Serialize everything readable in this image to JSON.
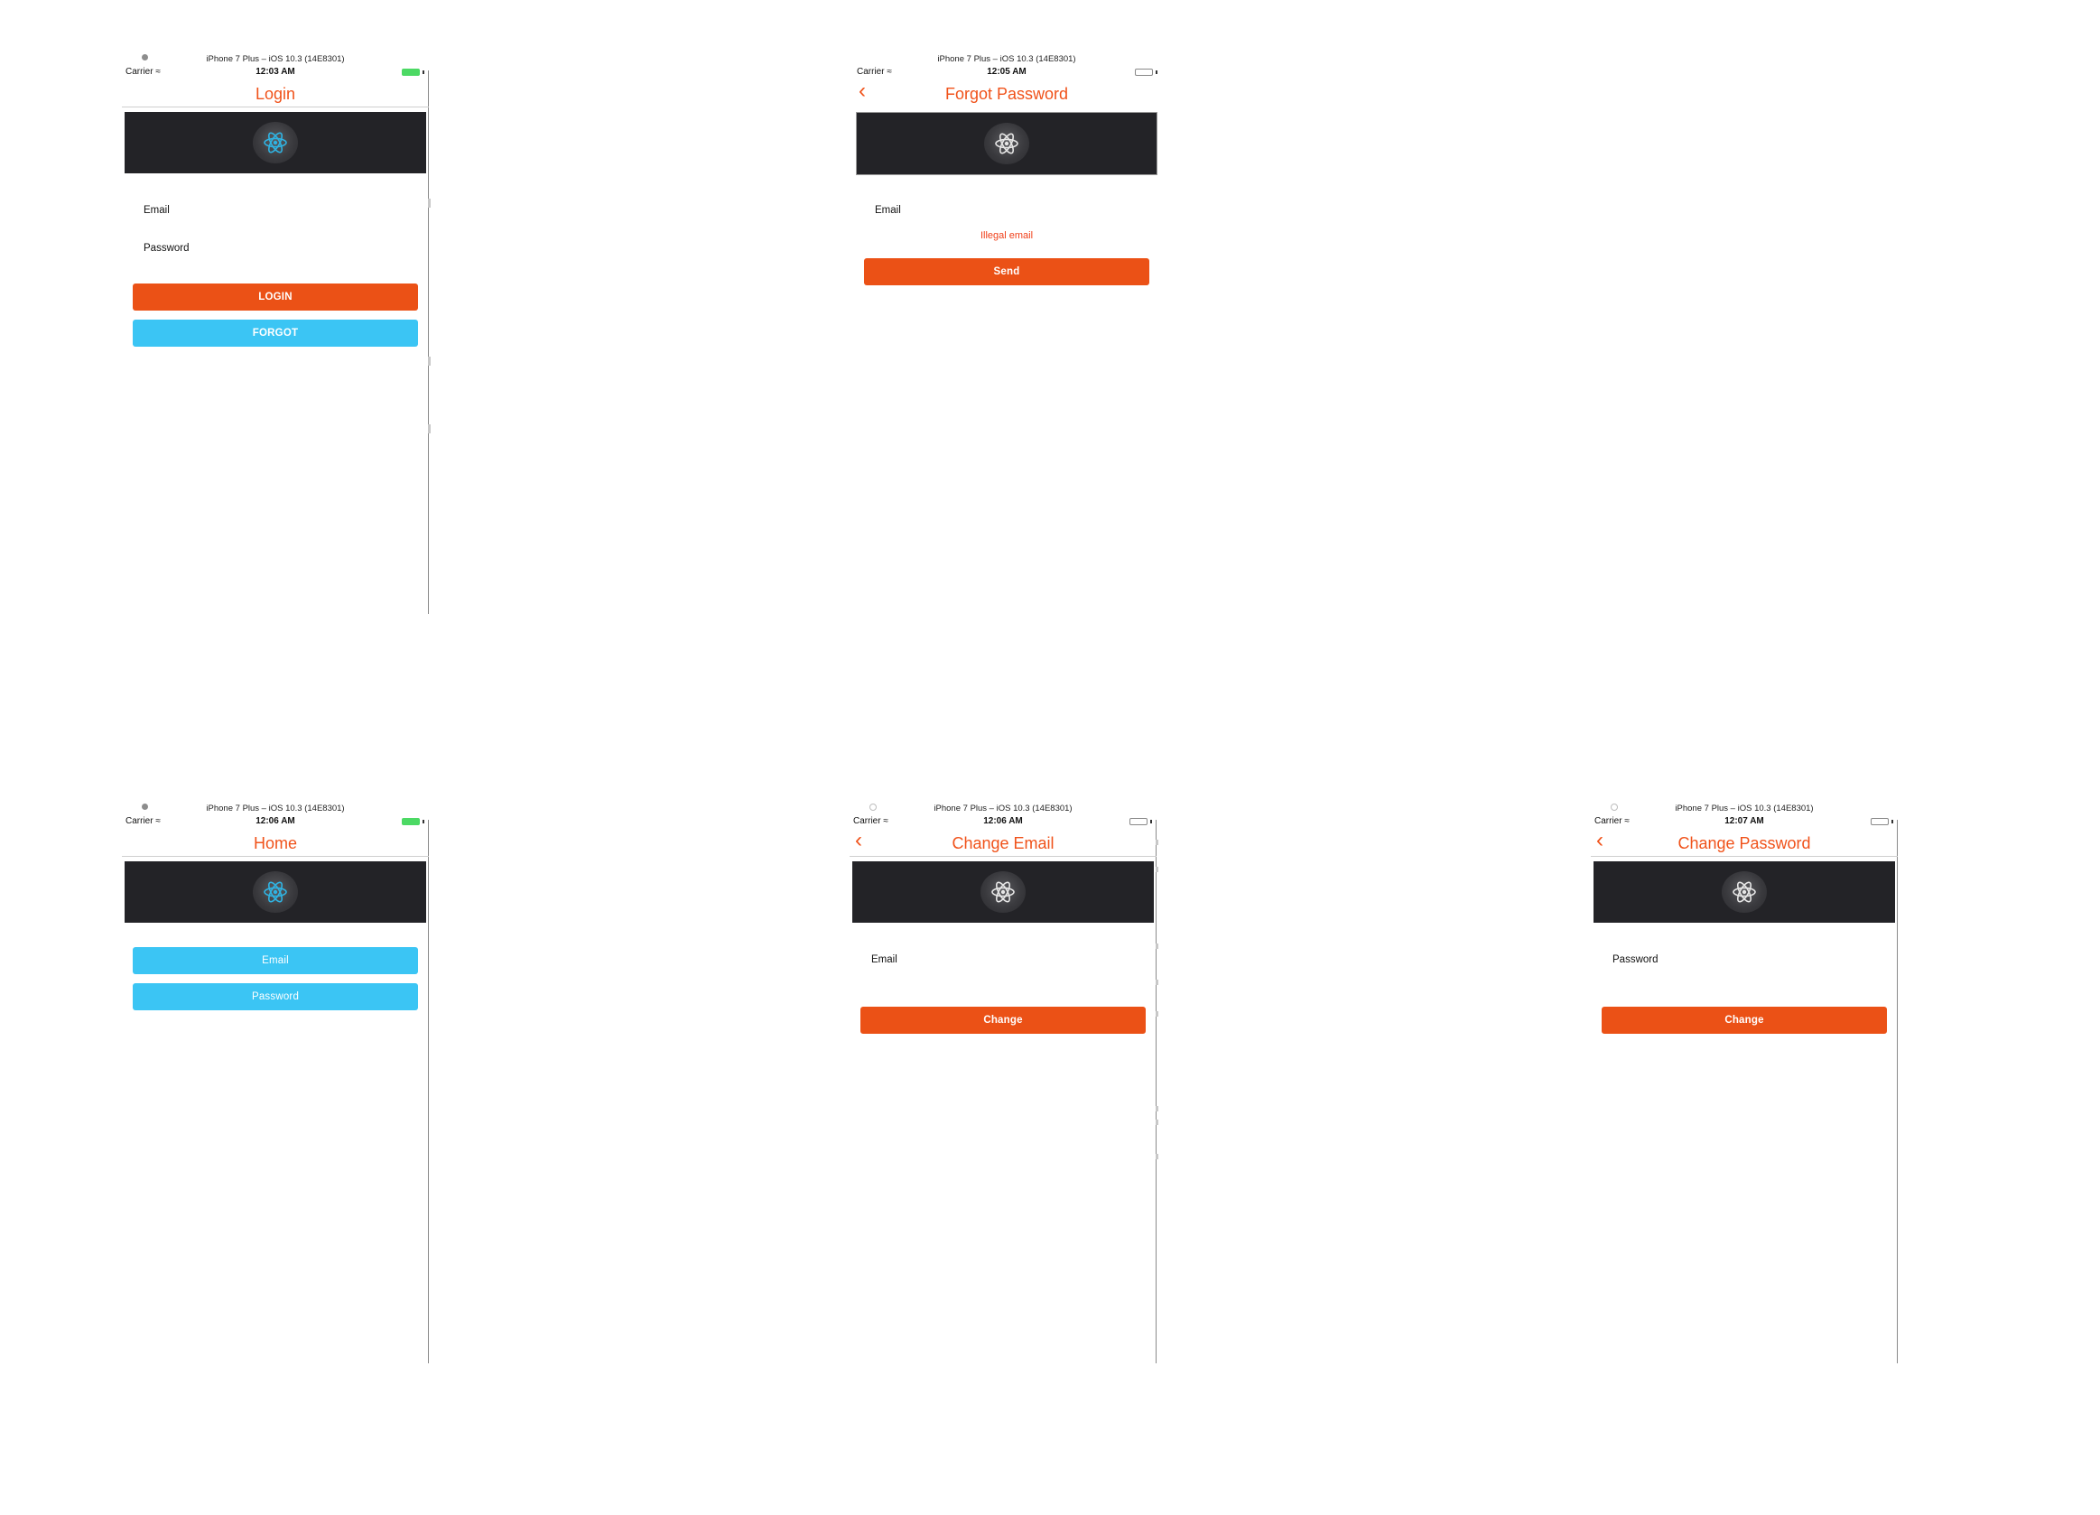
{
  "colors": {
    "accent": "#f0521a",
    "primary_button": "#eb5116",
    "secondary_button": "#3bc5f4",
    "banner": "#232327",
    "react_logo_cyan": "#2fb3e2"
  },
  "screens": {
    "login": {
      "sim_title": "iPhone 7 Plus – iOS 10.3 (14E8301)",
      "carrier": "Carrier",
      "time": "12:03 AM",
      "nav_title": "Login",
      "email_label": "Email",
      "password_label": "Password",
      "login_button": "LOGIN",
      "forgot_button": "FORGOT"
    },
    "forgot_password": {
      "sim_title": "iPhone 7 Plus – iOS 10.3 (14E8301)",
      "carrier": "Carrier",
      "time": "12:05 AM",
      "nav_title": "Forgot Password",
      "email_label": "Email",
      "error_text": "Illegal email",
      "send_button": "Send"
    },
    "home": {
      "sim_title": "iPhone 7 Plus – iOS 10.3 (14E8301)",
      "carrier": "Carrier",
      "time": "12:06 AM",
      "nav_title": "Home",
      "email_button": "Email",
      "password_button": "Password"
    },
    "change_email": {
      "sim_title": "iPhone 7 Plus – iOS 10.3 (14E8301)",
      "carrier": "Carrier",
      "time": "12:06 AM",
      "nav_title": "Change Email",
      "email_label": "Email",
      "change_button": "Change"
    },
    "change_password": {
      "sim_title": "iPhone 7 Plus – iOS 10.3 (14E8301)",
      "carrier": "Carrier",
      "time": "12:07 AM",
      "nav_title": "Change Password",
      "password_label": "Password",
      "change_button": "Change"
    }
  },
  "icons": {
    "back": "chevron-left-icon",
    "logo": "react-atom-icon",
    "wifi": "wifi-icon",
    "battery": "battery-icon"
  }
}
